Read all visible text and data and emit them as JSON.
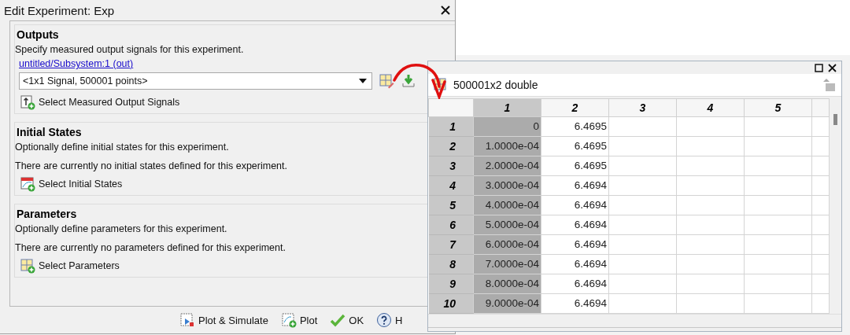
{
  "dialog": {
    "title": "Edit Experiment: Exp"
  },
  "sections": [
    {
      "kind": "outputs",
      "title": "Outputs",
      "description": "Specify measured output signals for this experiment.",
      "link": "untitled/Subsystem:1 (out)",
      "combo": {
        "value": "<1x1 Signal, 500001 points>"
      },
      "button": "Select Measured Output Signals"
    },
    {
      "kind": "states",
      "title": "Initial States",
      "description": "Optionally define initial states for this experiment.",
      "note": "There are currently no initial states defined for this experiment.",
      "button": "Select Initial States"
    },
    {
      "kind": "parameters",
      "title": "Parameters",
      "description": "Optionally define parameters for this experiment.",
      "note": "There are currently no parameters defined for this experiment.",
      "button": "Select Parameters"
    }
  ],
  "footer_buttons": [
    {
      "kind": "plot_simulate",
      "label": "Plot & Simulate"
    },
    {
      "kind": "plot",
      "label": "Plot"
    },
    {
      "kind": "ok",
      "label": "OK"
    },
    {
      "kind": "help",
      "label": "H"
    }
  ],
  "variable_window": {
    "title": "500001x2 double",
    "columns": [
      {
        "label": "1",
        "selected": true
      },
      {
        "label": "2",
        "selected": false
      },
      {
        "label": "3",
        "selected": false
      },
      {
        "label": "4",
        "selected": false
      },
      {
        "label": "5",
        "selected": false
      }
    ],
    "rows": [
      {
        "label": "1",
        "cells": [
          "0",
          "6.4695"
        ]
      },
      {
        "label": "2",
        "cells": [
          "1.0000e-04",
          "6.4695"
        ]
      },
      {
        "label": "3",
        "cells": [
          "2.0000e-04",
          "6.4695"
        ]
      },
      {
        "label": "4",
        "cells": [
          "3.0000e-04",
          "6.4694"
        ]
      },
      {
        "label": "5",
        "cells": [
          "4.0000e-04",
          "6.4694"
        ]
      },
      {
        "label": "6",
        "cells": [
          "5.0000e-04",
          "6.4694"
        ]
      },
      {
        "label": "7",
        "cells": [
          "6.0000e-04",
          "6.4694"
        ]
      },
      {
        "label": "8",
        "cells": [
          "7.0000e-04",
          "6.4694"
        ]
      },
      {
        "label": "9",
        "cells": [
          "8.0000e-04",
          "6.4694"
        ]
      },
      {
        "label": "10",
        "cells": [
          "9.0000e-04",
          "6.4694"
        ]
      }
    ]
  }
}
